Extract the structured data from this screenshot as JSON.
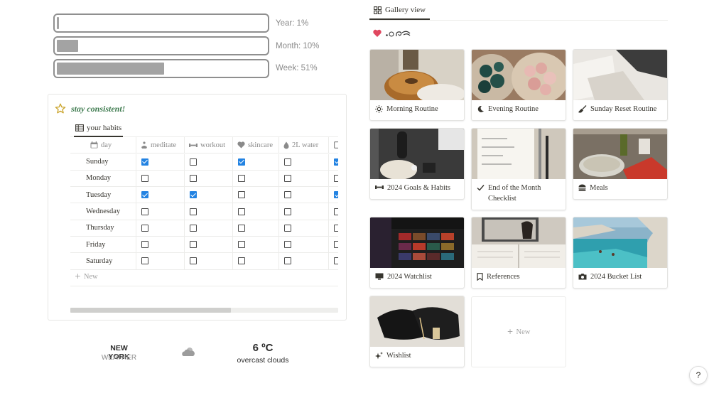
{
  "progress": {
    "year": {
      "label": "Year: 1%",
      "value": 0.01
    },
    "month": {
      "label": "Month: 10%",
      "value": 0.1
    },
    "week": {
      "label": "Week: 51%",
      "value": 0.51
    }
  },
  "habits": {
    "title": "stay consistent!",
    "view_tab": "your habits",
    "columns": [
      "day",
      "meditate",
      "workout",
      "skincare",
      "2L water"
    ],
    "rows": [
      {
        "day": "Sunday",
        "checks": [
          true,
          false,
          true,
          false,
          true
        ]
      },
      {
        "day": "Monday",
        "checks": [
          false,
          false,
          false,
          false,
          false
        ]
      },
      {
        "day": "Tuesday",
        "checks": [
          true,
          true,
          false,
          false,
          true
        ]
      },
      {
        "day": "Wednesday",
        "checks": [
          false,
          false,
          false,
          false,
          false
        ]
      },
      {
        "day": "Thursday",
        "checks": [
          false,
          false,
          false,
          false,
          false
        ]
      },
      {
        "day": "Friday",
        "checks": [
          false,
          false,
          false,
          false,
          false
        ]
      },
      {
        "day": "Saturday",
        "checks": [
          false,
          false,
          false,
          false,
          false
        ]
      }
    ],
    "new_label": "New",
    "scroll_position": 0.6
  },
  "weather": {
    "city": "NEW YORK",
    "subtitle": "WEATHER",
    "temperature": "6 ºC",
    "description": "overcast clouds",
    "icon": "cloud-sun-icon"
  },
  "gallery": {
    "tab_label": "Gallery view",
    "cards": [
      {
        "title": "Morning Routine",
        "icon": "sun-icon"
      },
      {
        "title": "Evening Routine",
        "icon": "moon-icon"
      },
      {
        "title": "Sunday Reset Routine",
        "icon": "broom-icon"
      },
      {
        "title": "2024 Goals & Habits",
        "icon": "dumbbell-icon"
      },
      {
        "title": "End of the Month Checklist",
        "icon": "check-icon"
      },
      {
        "title": "Meals",
        "icon": "burger-icon"
      },
      {
        "title": "2024 Watchlist",
        "icon": "monitor-icon"
      },
      {
        "title": "References",
        "icon": "bookmark-icon"
      },
      {
        "title": "2024 Bucket List",
        "icon": "camera-icon"
      },
      {
        "title": "Wishlist",
        "icon": "sparkle-icon"
      }
    ],
    "new_label": "New"
  },
  "help": "?",
  "colors": {
    "accent_blue": "#2383e2",
    "title_green": "#3d7a4e",
    "star_gold": "#c9a227",
    "heart_red": "#e0475f"
  }
}
